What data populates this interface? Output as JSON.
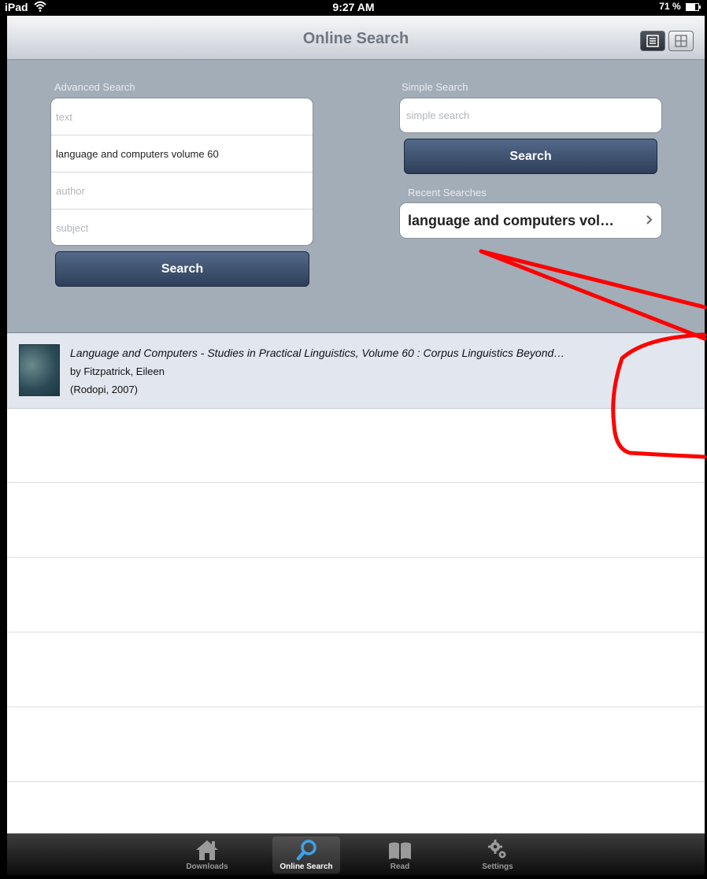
{
  "status_bar": {
    "device": "iPad",
    "time": "9:27 AM",
    "battery": "71 %"
  },
  "nav": {
    "title": "Online Search"
  },
  "advanced_search": {
    "label": "Advanced Search",
    "fields": [
      {
        "placeholder": "text",
        "value": ""
      },
      {
        "placeholder": "",
        "value": "language and computers volume 60"
      },
      {
        "placeholder": "author",
        "value": ""
      },
      {
        "placeholder": "subject",
        "value": ""
      }
    ],
    "button": "Search"
  },
  "simple_search": {
    "label": "Simple Search",
    "placeholder": "simple search",
    "button": "Search"
  },
  "recent_searches": {
    "label": "Recent Searches",
    "items": [
      "language and computers vol…"
    ]
  },
  "results": [
    {
      "title": "Language and Computers - Studies in Practical Linguistics, Volume 60 : Corpus Linguistics Beyond…",
      "author": "by Fitzpatrick, Eileen",
      "publisher": "(Rodopi, 2007)"
    }
  ],
  "tabs": [
    {
      "label": "Downloads",
      "icon": "house-icon"
    },
    {
      "label": "Online Search",
      "icon": "magnifier-icon",
      "active": true
    },
    {
      "label": "Read",
      "icon": "book-icon"
    },
    {
      "label": "Settings",
      "icon": "gears-icon"
    }
  ],
  "colors": {
    "panel": "#a3adb8",
    "button": "#2d3f59",
    "annotation": "#ff0000"
  }
}
